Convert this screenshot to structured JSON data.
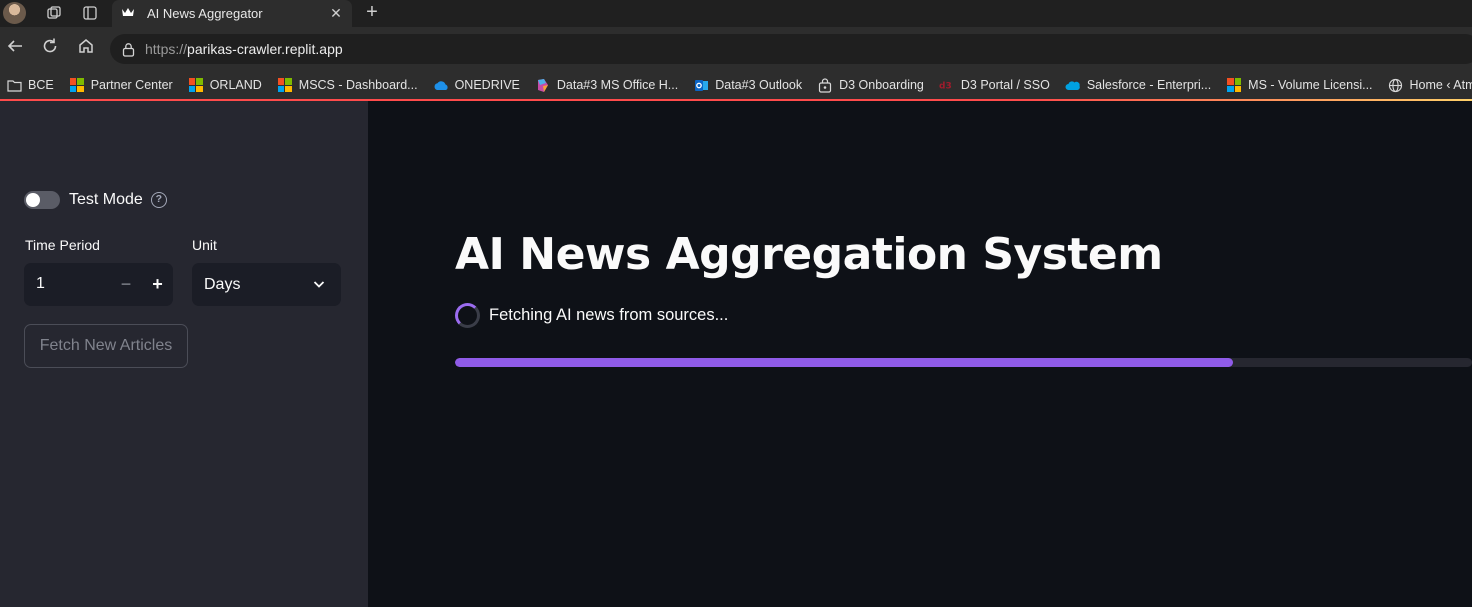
{
  "browser": {
    "tab_title": "AI News Aggregator",
    "url_scheme": "https://",
    "url_host": "parikas-crawler.replit.app",
    "bookmarks": [
      {
        "label": "BCE",
        "icon": "folder-icon"
      },
      {
        "label": "Partner Center",
        "icon": "microsoft-icon"
      },
      {
        "label": "ORLAND",
        "icon": "microsoft-icon"
      },
      {
        "label": "MSCS - Dashboard...",
        "icon": "microsoft-icon"
      },
      {
        "label": "ONEDRIVE",
        "icon": "onedrive-icon"
      },
      {
        "label": "Data#3 MS Office H...",
        "icon": "office-icon"
      },
      {
        "label": "Data#3 Outlook",
        "icon": "outlook-icon"
      },
      {
        "label": "D3 Onboarding",
        "icon": "lock-bag-icon"
      },
      {
        "label": "D3 Portal / SSO",
        "icon": "d3-icon"
      },
      {
        "label": "Salesforce - Enterpri...",
        "icon": "salesforce-icon"
      },
      {
        "label": "MS - Volume Licensi...",
        "icon": "microsoft-icon"
      },
      {
        "label": "Home ‹ Atman Aca...",
        "icon": "globe-icon"
      }
    ]
  },
  "sidebar": {
    "test_mode": {
      "label": "Test Mode",
      "enabled": false
    },
    "time_period": {
      "label": "Time Period",
      "value": "1",
      "minus": "−",
      "plus": "+"
    },
    "unit": {
      "label": "Unit",
      "value": "Days"
    },
    "fetch_button": "Fetch New Articles"
  },
  "main": {
    "title": "AI News Aggregation System",
    "status": "Fetching AI news from sources...",
    "progress": 0.765
  },
  "colors": {
    "accent_progress": "#8f5be8",
    "spinner": "#9b6cf0",
    "sidebar_bg": "#262730",
    "main_bg": "#0e1117",
    "header_line": "#ff4b4b"
  }
}
